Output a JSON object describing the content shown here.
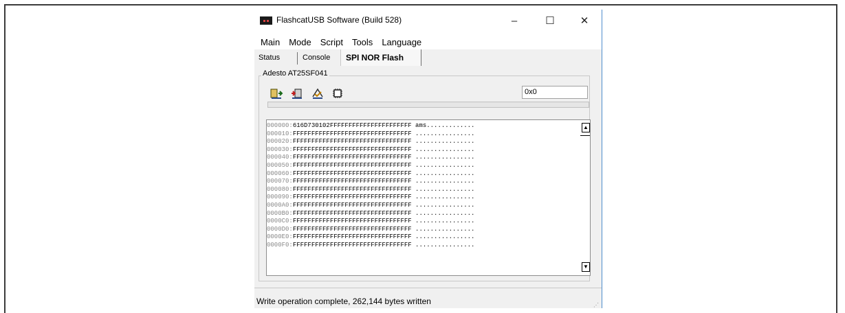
{
  "window": {
    "title": "FlashcatUSB Software (Build 528)",
    "controls": {
      "minimize": "–",
      "maximize": "☐",
      "close": "✕"
    }
  },
  "menu": [
    "Main",
    "Mode",
    "Script",
    "Tools",
    "Language"
  ],
  "tabs": [
    "Status",
    "Console",
    "SPI NOR Flash"
  ],
  "active_tab": "SPI NOR Flash",
  "device": {
    "name": "Adesto AT25SF041",
    "address": "0x0",
    "toolbar": [
      "read-chip-icon",
      "write-chip-icon",
      "verify-icon",
      "erase-chip-icon"
    ]
  },
  "hex": [
    {
      "off": "000000:",
      "data": "616D730102FFFFFFFFFFFFFFFFFFFFFF",
      "ascii": "ams............."
    },
    {
      "off": "000010:",
      "data": "FFFFFFFFFFFFFFFFFFFFFFFFFFFFFFFF",
      "ascii": "................"
    },
    {
      "off": "000020:",
      "data": "FFFFFFFFFFFFFFFFFFFFFFFFFFFFFFFF",
      "ascii": "................"
    },
    {
      "off": "000030:",
      "data": "FFFFFFFFFFFFFFFFFFFFFFFFFFFFFFFF",
      "ascii": "................"
    },
    {
      "off": "000040:",
      "data": "FFFFFFFFFFFFFFFFFFFFFFFFFFFFFFFF",
      "ascii": "................"
    },
    {
      "off": "000050:",
      "data": "FFFFFFFFFFFFFFFFFFFFFFFFFFFFFFFF",
      "ascii": "................"
    },
    {
      "off": "000060:",
      "data": "FFFFFFFFFFFFFFFFFFFFFFFFFFFFFFFF",
      "ascii": "................"
    },
    {
      "off": "000070:",
      "data": "FFFFFFFFFFFFFFFFFFFFFFFFFFFFFFFF",
      "ascii": "................"
    },
    {
      "off": "000080:",
      "data": "FFFFFFFFFFFFFFFFFFFFFFFFFFFFFFFF",
      "ascii": "................"
    },
    {
      "off": "000090:",
      "data": "FFFFFFFFFFFFFFFFFFFFFFFFFFFFFFFF",
      "ascii": "................"
    },
    {
      "off": "0000A0:",
      "data": "FFFFFFFFFFFFFFFFFFFFFFFFFFFFFFFF",
      "ascii": "................"
    },
    {
      "off": "0000B0:",
      "data": "FFFFFFFFFFFFFFFFFFFFFFFFFFFFFFFF",
      "ascii": "................"
    },
    {
      "off": "0000C0:",
      "data": "FFFFFFFFFFFFFFFFFFFFFFFFFFFFFFFF",
      "ascii": "................"
    },
    {
      "off": "0000D0:",
      "data": "FFFFFFFFFFFFFFFFFFFFFFFFFFFFFFFF",
      "ascii": "................"
    },
    {
      "off": "0000E0:",
      "data": "FFFFFFFFFFFFFFFFFFFFFFFFFFFFFFFF",
      "ascii": "................"
    },
    {
      "off": "0000F0:",
      "data": "FFFFFFFFFFFFFFFFFFFFFFFFFFFFFFFF",
      "ascii": "................"
    }
  ],
  "status": "Write operation complete, 262,144 bytes written",
  "colors": {
    "window_border": "#4d8ccc",
    "panel": "#f0f0f0",
    "offset_text": "#8a8a8a"
  }
}
